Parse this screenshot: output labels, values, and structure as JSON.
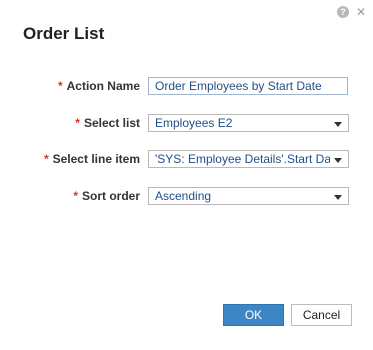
{
  "dialog": {
    "title": "Order List",
    "help_icon": "help-icon",
    "close_icon": "close-icon"
  },
  "fields": {
    "action_name": {
      "required": "*",
      "label": "Action Name",
      "value": "Order Employees by Start Date"
    },
    "select_list": {
      "required": "*",
      "label": "Select list",
      "value": "Employees E2"
    },
    "select_line_item": {
      "required": "*",
      "label": "Select line item",
      "value": "'SYS: Employee Details'.Start Date"
    },
    "sort_order": {
      "required": "*",
      "label": "Sort order",
      "value": "Ascending"
    }
  },
  "buttons": {
    "ok": "OK",
    "cancel": "Cancel"
  },
  "colors": {
    "primary": "#3d86c6",
    "required": "#d9302b",
    "value_text": "#1f4f86"
  }
}
